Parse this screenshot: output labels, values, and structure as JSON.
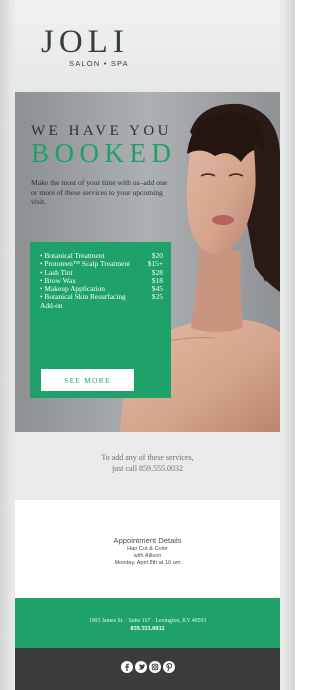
{
  "brand": {
    "name": "JOLI",
    "tagline": "SALON • SPA"
  },
  "hero": {
    "title_line1": "WE HAVE YOU",
    "title_line2": "BOOKED",
    "description": "Make the most of your time with us–add one or more of these services to your upcoming visit."
  },
  "services": [
    {
      "name": "• Botanical Treatment",
      "price": "$20"
    },
    {
      "name": "• Prototeen™ Scalp Treatment",
      "price": "$15+"
    },
    {
      "name": "• Lash Tint",
      "price": "$28"
    },
    {
      "name": "• Brow Wax",
      "price": "$18"
    },
    {
      "name": "• Makeup Application",
      "price": "$45"
    },
    {
      "name": "• Botanical Skin Resurfacing Add-on",
      "price": "$25"
    }
  ],
  "see_more_label": "SEE MORE",
  "cta": {
    "line1": "To add any of these services,",
    "line2": "just call 859.555.0032"
  },
  "appointment": {
    "title": "Appointment Details",
    "line1": "Hair Cut & Color",
    "line2": "with Allison",
    "line3": "Monday, April 8th at 10 am"
  },
  "footer": {
    "address": "1903 James St. · Suite 167 · Lexington, KY 40503",
    "phone": "859.555.0032"
  },
  "social": {
    "icons": [
      "facebook-icon",
      "twitter-icon",
      "instagram-icon",
      "pinterest-icon"
    ]
  },
  "colors": {
    "accent_green": "#1fa26a",
    "dark_bar": "#3b3c3e",
    "light_bg": "#e9eaea"
  }
}
